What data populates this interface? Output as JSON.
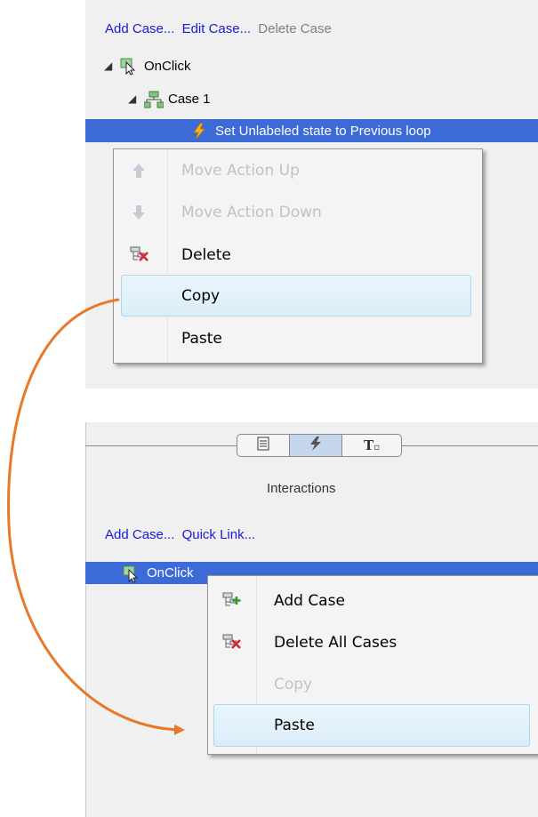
{
  "top": {
    "links": [
      {
        "label": "Add Case...",
        "enabled": true
      },
      {
        "label": "Edit Case...",
        "enabled": true
      },
      {
        "label": "Delete Case",
        "enabled": false
      }
    ],
    "tree": {
      "event": "OnClick",
      "case": "Case 1",
      "action": "Set Unlabeled state to Previous loop"
    },
    "menu": [
      {
        "label": "Move Action Up",
        "enabled": false,
        "icon": "arrow-up-icon"
      },
      {
        "label": "Move Action Down",
        "enabled": false,
        "icon": "arrow-down-icon"
      },
      {
        "label": "Delete",
        "enabled": true,
        "icon": "delete-case-icon"
      },
      {
        "label": "Copy",
        "enabled": true,
        "highlighted": true
      },
      {
        "label": "Paste",
        "enabled": true
      }
    ]
  },
  "bottom": {
    "tabs": [
      {
        "icon": "properties-icon",
        "selected": false
      },
      {
        "icon": "interactions-icon",
        "selected": true
      },
      {
        "icon": "style-icon",
        "selected": false,
        "text": "T"
      }
    ],
    "caption": "Interactions",
    "links": [
      {
        "label": "Add Case...",
        "enabled": true
      },
      {
        "label": "Quick Link...",
        "enabled": true
      }
    ],
    "event": "OnClick",
    "menu": [
      {
        "label": "Add Case",
        "enabled": true,
        "icon": "add-case-icon"
      },
      {
        "label": "Delete All Cases",
        "enabled": true,
        "icon": "delete-case-icon"
      },
      {
        "label": "Copy",
        "enabled": false
      },
      {
        "label": "Paste",
        "enabled": true,
        "highlighted": true
      }
    ]
  },
  "colors": {
    "arrow": "#e8792a",
    "selection": "#3c6bd8",
    "link": "#1a1ad8"
  }
}
